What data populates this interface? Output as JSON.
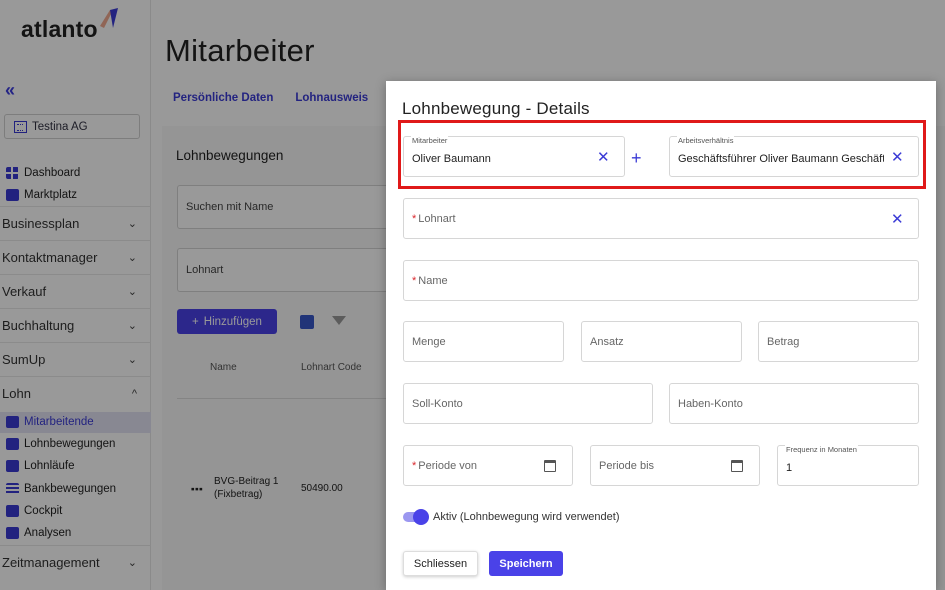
{
  "app": {
    "logo": "atlanto",
    "collapse_icon": "«",
    "organization": "Testina AG",
    "page_title": "Mitarbeiter"
  },
  "sidebar": {
    "top_items": [
      {
        "label": "Dashboard",
        "icon": "dashboard-icon"
      },
      {
        "label": "Marktplatz",
        "icon": "store-icon"
      }
    ],
    "groups": [
      {
        "label": "Businessplan",
        "chevron": "⌄"
      },
      {
        "label": "Kontaktmanager",
        "chevron": "⌄"
      },
      {
        "label": "Verkauf",
        "chevron": "⌄"
      },
      {
        "label": "Buchhaltung",
        "chevron": "⌄"
      },
      {
        "label": "SumUp",
        "chevron": "⌄"
      },
      {
        "label": "Lohn",
        "chevron": "^"
      }
    ],
    "lohn_items": [
      {
        "label": "Mitarbeitende",
        "icon": "employees-icon",
        "active": true
      },
      {
        "label": "Lohnbewegungen",
        "icon": "payment-icon"
      },
      {
        "label": "Lohnläufe",
        "icon": "payroll-run-icon"
      },
      {
        "label": "Bankbewegungen",
        "icon": "bank-icon"
      },
      {
        "label": "Cockpit",
        "icon": "cockpit-icon"
      },
      {
        "label": "Analysen",
        "icon": "analytics-icon"
      }
    ],
    "bottom_group": {
      "label": "Zeitmanagement",
      "chevron": "⌄"
    }
  },
  "background": {
    "tabs": [
      "Persönliche Daten",
      "Lohnausweis"
    ],
    "section_title": "Lohnbewegungen",
    "search_placeholder": "Suchen mit Name",
    "lohnart_placeholder": "Lohnart",
    "add_button": "Hinzufügen",
    "add_icon": "+",
    "columns": [
      "Name",
      "Lohnart Code"
    ],
    "row": {
      "name_line1": "BVG-Beitrag 1",
      "name_line2": "(Fixbetrag)",
      "code": "50490.00",
      "menu": "⋮"
    }
  },
  "modal": {
    "title": "Lohnbewegung - Details",
    "mitarbeiter": {
      "label": "Mitarbeiter",
      "value": "Oliver Baumann"
    },
    "arbeitsverhaeltnis": {
      "label": "Arbeitsverhältnis",
      "value": "Geschäftsführer Oliver Baumann Geschäftsführer"
    },
    "clear_icon": "✕",
    "plus_icon": "+",
    "required_mark": "*",
    "lohnart": "Lohnart",
    "name": "Name",
    "menge": "Menge",
    "ansatz": "Ansatz",
    "betrag": "Betrag",
    "soll_konto": "Soll-Konto",
    "haben_konto": "Haben-Konto",
    "periode_von": "Periode von",
    "periode_bis": "Periode bis",
    "frequenz": {
      "label": "Frequenz in Monaten",
      "value": "1"
    },
    "aktiv_label": "Aktiv (Lohnbewegung wird verwendet)",
    "aktiv_on": true,
    "close_button": "Schliessen",
    "save_button": "Speichern"
  },
  "colors": {
    "accent": "#4a42e8",
    "highlight": "#e01919",
    "required": "#d9262b"
  }
}
